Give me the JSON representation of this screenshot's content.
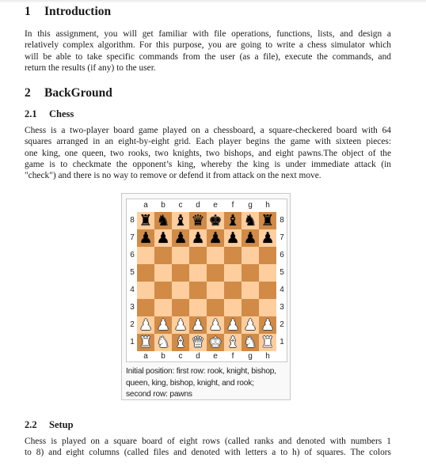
{
  "sections": [
    {
      "number": "1",
      "title": "Introduction",
      "paragraph_lines": [
        "In this assignment, you will get familiar with file operations, functions, lists, and design a",
        "relatively complex algorithm. For this purpose, you are going to write a chess simulator which",
        "will be able to take specific commands from the user (as a file), execute the commands, and",
        "return the results (if any) to the user."
      ]
    },
    {
      "number": "2",
      "title": "BackGround"
    }
  ],
  "subsections": [
    {
      "number": "2.1",
      "title": "Chess",
      "paragraph_lines": [
        "Chess is a two-player board game played on a chessboard, a square-checkered board with 64",
        "squares arranged in an eight-by-eight grid. Each player begins the game with sixteen pieces:",
        "one king, one queen, two rooks, two knights, two bishops, and eight pawns.The object of the",
        "game is to checkmate the opponent’s king, whereby the king is under immediate attack (in",
        "\"check\") and there is no way to remove or defend it from attack on the next move."
      ]
    },
    {
      "number": "2.2",
      "title": "Setup",
      "paragraph_lines": [
        "Chess is played on a square board of eight rows (called ranks and denoted with numbers 1",
        "to 8) and eight columns (called files and denoted with letters a to h) of squares. The colors"
      ]
    }
  ],
  "figure": {
    "files": [
      "a",
      "b",
      "c",
      "d",
      "e",
      "f",
      "g",
      "h"
    ],
    "ranks": [
      "8",
      "7",
      "6",
      "5",
      "4",
      "3",
      "2",
      "1"
    ],
    "colors": {
      "light_square": "#ffce9e",
      "dark_square": "#d18b47"
    },
    "position": [
      [
        "bR",
        "bN",
        "bB",
        "bQ",
        "bK",
        "bB",
        "bN",
        "bR"
      ],
      [
        "bP",
        "bP",
        "bP",
        "bP",
        "bP",
        "bP",
        "bP",
        "bP"
      ],
      [
        "",
        "",
        "",
        "",
        "",
        "",
        "",
        ""
      ],
      [
        "",
        "",
        "",
        "",
        "",
        "",
        "",
        ""
      ],
      [
        "",
        "",
        "",
        "",
        "",
        "",
        "",
        ""
      ],
      [
        "",
        "",
        "",
        "",
        "",
        "",
        "",
        ""
      ],
      [
        "wP",
        "wP",
        "wP",
        "wP",
        "wP",
        "wP",
        "wP",
        "wP"
      ],
      [
        "wR",
        "wN",
        "wB",
        "wQ",
        "wK",
        "wB",
        "wN",
        "wR"
      ]
    ],
    "piece_glyphs": {
      "R": "♜",
      "N": "♞",
      "B": "♝",
      "Q": "♛",
      "K": "♚",
      "P": "♟"
    },
    "piece_names": {
      "R": "rook",
      "N": "knight",
      "B": "bishop",
      "Q": "queen",
      "K": "king",
      "P": "pawn"
    },
    "caption_lines": [
      "Initial position: first row: rook, knight, bishop,",
      "queen, king, bishop, knight, and rook;",
      "second row: pawns"
    ]
  }
}
